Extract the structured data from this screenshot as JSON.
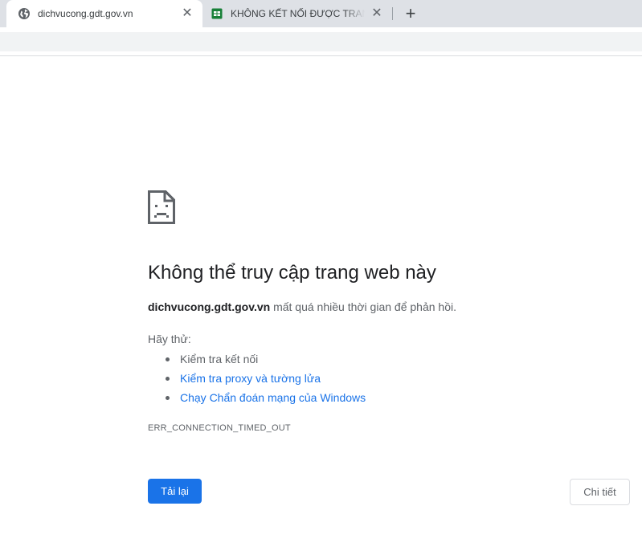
{
  "tabs": [
    {
      "title": "dichvucong.gdt.gov.vn",
      "favicon": "globe-icon",
      "active": true
    },
    {
      "title": "KHÔNG KẾT NỐI ĐƯỢC TRANG DỊCH VỤ CÔNG",
      "favicon": "sheets-icon",
      "active": false
    }
  ],
  "new_tab_glyph": "+",
  "close_glyph": "✕",
  "colors": {
    "accent": "#1a73e8",
    "tabstrip": "#dee1e6",
    "sheets_green": "#188038"
  },
  "error": {
    "icon": "sad-page-icon",
    "title": "Không thể truy cập trang web này",
    "host": "dichvucong.gdt.gov.vn",
    "description": "mất quá nhiều thời gian để phản hồi.",
    "try_label": "Hãy thử:",
    "suggestions": [
      {
        "text": "Kiểm tra kết nối",
        "link": false
      },
      {
        "text": "Kiểm tra proxy và tường lửa",
        "link": true
      },
      {
        "text": "Chạy Chẩn đoán mạng của Windows",
        "link": true
      }
    ],
    "code": "ERR_CONNECTION_TIMED_OUT",
    "reload_label": "Tải lại",
    "details_label": "Chi tiết"
  }
}
